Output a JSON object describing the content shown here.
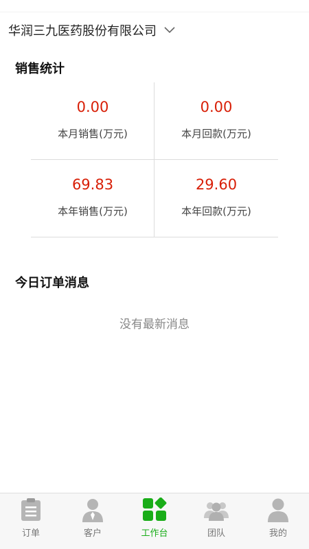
{
  "header": {
    "company_name": "华润三九医药股份有限公司",
    "dropdown_icon": "chevron-down-icon"
  },
  "sales": {
    "title": "销售统计",
    "stats": [
      {
        "value": "0.00",
        "label": "本月销售(万元)"
      },
      {
        "value": "0.00",
        "label": "本月回款(万元)"
      },
      {
        "value": "69.83",
        "label": "本年销售(万元)"
      },
      {
        "value": "29.60",
        "label": "本年回款(万元)"
      }
    ],
    "value_color": "#d81e06"
  },
  "orders": {
    "title": "今日订单消息",
    "empty_text": "没有最新消息"
  },
  "tabbar": {
    "active_color": "#1aad19",
    "inactive_color": "#b5b5b5",
    "items": [
      {
        "label": "订单",
        "icon": "clipboard-icon"
      },
      {
        "label": "客户",
        "icon": "person-tie-icon"
      },
      {
        "label": "工作台",
        "icon": "workbench-grid-icon",
        "active": true
      },
      {
        "label": "团队",
        "icon": "group-icon"
      },
      {
        "label": "我的",
        "icon": "user-icon"
      }
    ]
  }
}
